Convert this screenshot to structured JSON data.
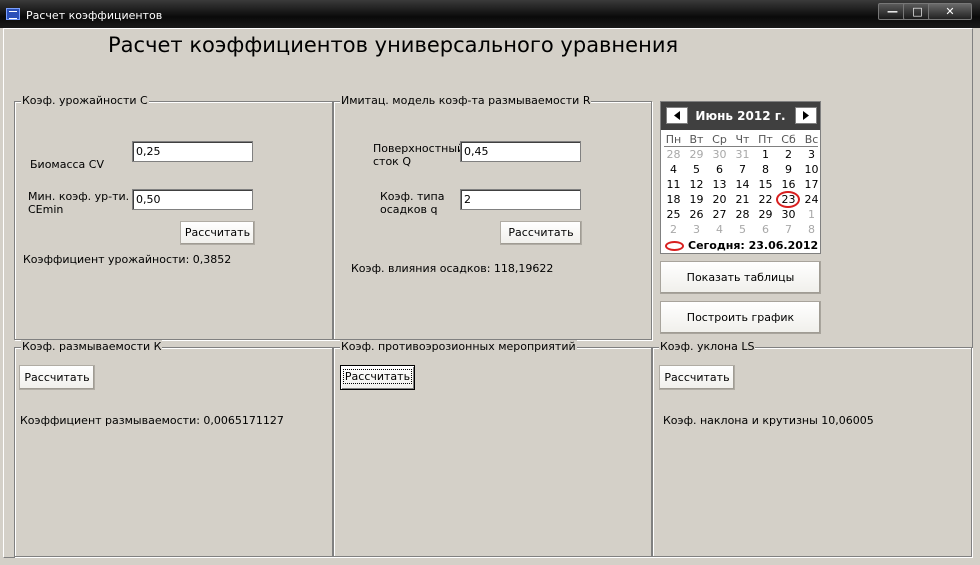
{
  "window": {
    "title": "Расчет коэффициентов",
    "minimize": "—",
    "maximize": "□",
    "close": "✕"
  },
  "headline": "Расчет коэффициентов универсального уравнения",
  "groups": {
    "yield": {
      "legend": "Коэф. урожайности С",
      "biomass_label": "Биомасса CV",
      "biomass_value": "0,25",
      "min_coef_label_1": "Мин. коэф. ур-ти.",
      "min_coef_label_2": "CEmin",
      "min_coef_value": "0,50",
      "calc_button": "Рассчитать",
      "result": "Коэффициент урожайности: 0,3852"
    },
    "erosion_model": {
      "legend": "Имитац. модель коэф-та размываемости R",
      "runoff_label_1": "Поверхностный",
      "runoff_label_2": "сток Q",
      "runoff_value": "0,45",
      "precip_label_1": "Коэф. типа",
      "precip_label_2": "осадков q",
      "precip_value": "2",
      "calc_button": "Рассчитать",
      "result": "Коэф. влияния осадков: 118,19622"
    },
    "erodibility": {
      "legend": "Коэф. размываемости К",
      "calc_button": "Рассчитать",
      "result": "Коэффициент размываемости: 0,0065171127"
    },
    "anti_erosion": {
      "legend": "Коэф. противоэрозионных мероприятий",
      "calc_button": "Рассчитать"
    },
    "slope": {
      "legend": "Коэф. уклона LS",
      "calc_button": "Рассчитать",
      "result": "Коэф. наклона и крутизны 10,06005"
    }
  },
  "calendar": {
    "month_label": "Июнь 2012 г.",
    "weekdays": [
      "Пн",
      "Вт",
      "Ср",
      "Чт",
      "Пт",
      "Сб",
      "Вс"
    ],
    "weeks": [
      [
        "28",
        "29",
        "30",
        "31",
        "1",
        "2",
        "3"
      ],
      [
        "4",
        "5",
        "6",
        "7",
        "8",
        "9",
        "10"
      ],
      [
        "11",
        "12",
        "13",
        "14",
        "15",
        "16",
        "17"
      ],
      [
        "18",
        "19",
        "20",
        "21",
        "22",
        "23",
        "24"
      ],
      [
        "25",
        "26",
        "27",
        "28",
        "29",
        "30",
        "1"
      ],
      [
        "2",
        "3",
        "4",
        "5",
        "6",
        "7",
        "8"
      ]
    ],
    "muted": [
      [
        0,
        0
      ],
      [
        0,
        1
      ],
      [
        0,
        2
      ],
      [
        0,
        3
      ],
      [
        4,
        6
      ],
      [
        5,
        0
      ],
      [
        5,
        1
      ],
      [
        5,
        2
      ],
      [
        5,
        3
      ],
      [
        5,
        4
      ],
      [
        5,
        5
      ],
      [
        5,
        6
      ]
    ],
    "selected_day": "23",
    "today_text": "Сегодня: 23.06.2012",
    "today_color": "#d81f1f"
  },
  "side_buttons": {
    "show_tables": "Показать таблицы",
    "build_chart": "Построить график"
  }
}
